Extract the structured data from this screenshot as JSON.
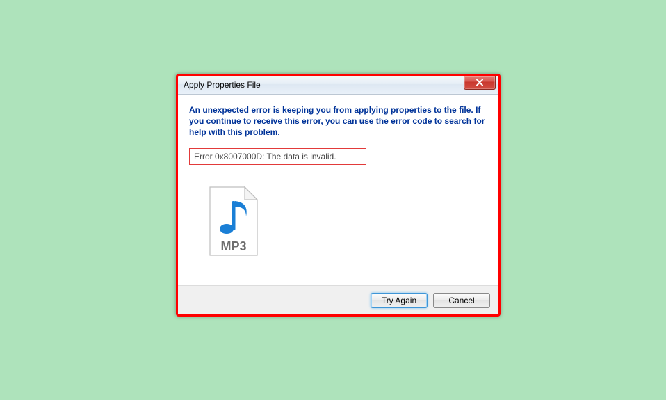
{
  "dialog": {
    "title": "Apply Properties File",
    "message": "An unexpected error is keeping you from applying properties to the file. If you continue to receive this error, you can use the error code to search for help with this problem.",
    "error_text": "Error 0x8007000D: The data is invalid.",
    "file_type_label": "MP3",
    "buttons": {
      "try_again": "Try Again",
      "cancel": "Cancel"
    }
  }
}
